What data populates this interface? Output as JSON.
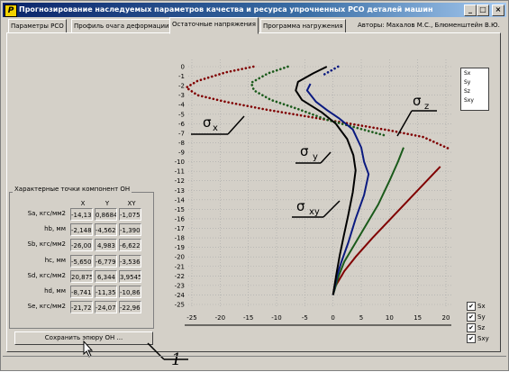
{
  "window": {
    "title": "Прогнозирование наследуемых параметров качества и ресурса упрочненных РСО деталей машин",
    "minimize": "_",
    "maximize": "□",
    "close": "×"
  },
  "tabs": [
    {
      "label": "Параметры РСО"
    },
    {
      "label": "Профиль очага деформации"
    },
    {
      "label": "Остаточные напряжения"
    },
    {
      "label": "Программа нагружения"
    }
  ],
  "authors": "Авторы: Махалов М.С., Блюменштейн В.Ю.",
  "points_group": {
    "title": "Характерные точки компонент ОН",
    "columns": [
      "X",
      "Y",
      "XY"
    ],
    "rows": [
      {
        "label": "Sa, кгс/мм2",
        "values": [
          "-14,13",
          "0,8684",
          "-1,075"
        ]
      },
      {
        "label": "hb, мм",
        "values": [
          "-2,148",
          "-4,562",
          "-1,390"
        ]
      },
      {
        "label": "Sb, кгс/мм2",
        "values": [
          "-26,00",
          "4,983",
          "-6,622"
        ]
      },
      {
        "label": "hc, мм",
        "values": [
          "-5,650",
          "-6,779",
          "-3,536"
        ]
      },
      {
        "label": "Sd, кгс/мм2",
        "values": [
          "20,875",
          "6,344",
          "3,9545"
        ]
      },
      {
        "label": "hd, мм",
        "values": [
          "-8,741",
          "-11,35",
          "-10,86"
        ]
      },
      {
        "label": "Se, кгс/мм2",
        "values": [
          "-21,72",
          "-24,07",
          "-22,96"
        ]
      }
    ]
  },
  "save_button": "Сохранить эпюру ОН ...",
  "callout": "1",
  "legend": [
    "Sx",
    "Sy",
    "Sz",
    "Sxy"
  ],
  "toggles": [
    {
      "label": "Sx",
      "checked": true
    },
    {
      "label": "Sy",
      "checked": true
    },
    {
      "label": "Sz",
      "checked": true
    },
    {
      "label": "Sxy",
      "checked": true
    }
  ],
  "chart_data": {
    "type": "line",
    "xlim": [
      -27,
      22
    ],
    "ylim": [
      -26,
      0.5
    ],
    "x_ticks": [
      -25,
      -20,
      -15,
      -10,
      -5,
      0,
      5,
      10,
      15,
      20
    ],
    "y_ticks": [
      0,
      -1,
      -2,
      -3,
      -4,
      -5,
      -6,
      -7,
      -8,
      -9,
      -10,
      -11,
      -12,
      -13,
      -14,
      -15,
      -16,
      -17,
      -18,
      -19,
      -20,
      -21,
      -22,
      -23,
      -24,
      -25
    ],
    "grid": true,
    "annotations": [
      {
        "base": "σ",
        "sub": "x"
      },
      {
        "base": "σ",
        "sub": "y"
      },
      {
        "base": "σ",
        "sub": "z"
      },
      {
        "base": "σ",
        "sub": "xy"
      }
    ],
    "series": [
      {
        "name": "Sx",
        "color": "#800000",
        "dotted_to": -9,
        "points": [
          [
            -14.1,
            0
          ],
          [
            -19,
            -0.6
          ],
          [
            -24,
            -1.5
          ],
          [
            -26,
            -2.2
          ],
          [
            -24,
            -3
          ],
          [
            -19,
            -3.7
          ],
          [
            -12,
            -4.5
          ],
          [
            -5,
            -5.2
          ],
          [
            3,
            -6
          ],
          [
            10,
            -6.7
          ],
          [
            16,
            -7.4
          ],
          [
            20.8,
            -8.7
          ],
          [
            19,
            -10.5
          ],
          [
            15,
            -13
          ],
          [
            11,
            -15.5
          ],
          [
            7,
            -18
          ],
          [
            4,
            -20
          ],
          [
            2,
            -21.5
          ],
          [
            0.5,
            -23
          ],
          [
            0,
            -24
          ]
        ]
      },
      {
        "name": "Sz",
        "color": "#1a5a1a",
        "dotted_to": -8,
        "points": [
          [
            -8,
            0
          ],
          [
            -11.5,
            -0.7
          ],
          [
            -14.5,
            -1.7
          ],
          [
            -14,
            -2.5
          ],
          [
            -11,
            -3.5
          ],
          [
            -6,
            -4.5
          ],
          [
            -1,
            -5.6
          ],
          [
            4,
            -6.4
          ],
          [
            9,
            -7.2
          ],
          [
            12.5,
            -8.5
          ],
          [
            11.5,
            -10
          ],
          [
            10,
            -12
          ],
          [
            8,
            -14.5
          ],
          [
            6,
            -16.5
          ],
          [
            4,
            -18.5
          ],
          [
            2,
            -20.5
          ],
          [
            1,
            -22
          ],
          [
            0,
            -24
          ]
        ]
      },
      {
        "name": "Sy",
        "color": "#0a1a80",
        "dotted_to": -1,
        "points": [
          [
            0.9,
            0
          ],
          [
            -1.5,
            -0.8
          ],
          [
            -4,
            -1.8
          ],
          [
            -4.6,
            -2.5
          ],
          [
            -3,
            -3.7
          ],
          [
            -1,
            -4.6
          ],
          [
            1,
            -5.4
          ],
          [
            3.5,
            -6.6
          ],
          [
            5,
            -8.5
          ],
          [
            5.5,
            -10
          ],
          [
            6.3,
            -11.3
          ],
          [
            5.5,
            -13.5
          ],
          [
            4,
            -16
          ],
          [
            2.7,
            -18.5
          ],
          [
            1.5,
            -20.5
          ],
          [
            0.7,
            -22
          ],
          [
            0,
            -24
          ]
        ]
      },
      {
        "name": "Sxy",
        "color": "#000000",
        "dotted_to": 1,
        "points": [
          [
            -1.1,
            0
          ],
          [
            -3.5,
            -0.7
          ],
          [
            -6.2,
            -1.6
          ],
          [
            -6.6,
            -2.5
          ],
          [
            -5.5,
            -3.5
          ],
          [
            -2,
            -4.8
          ],
          [
            0.5,
            -6
          ],
          [
            2.5,
            -7.6
          ],
          [
            3.6,
            -9.3
          ],
          [
            4,
            -10.9
          ],
          [
            3.5,
            -13.2
          ],
          [
            2.7,
            -15.6
          ],
          [
            1.9,
            -17.8
          ],
          [
            1.2,
            -19.8
          ],
          [
            0.6,
            -21.8
          ],
          [
            0,
            -24
          ]
        ]
      }
    ]
  }
}
